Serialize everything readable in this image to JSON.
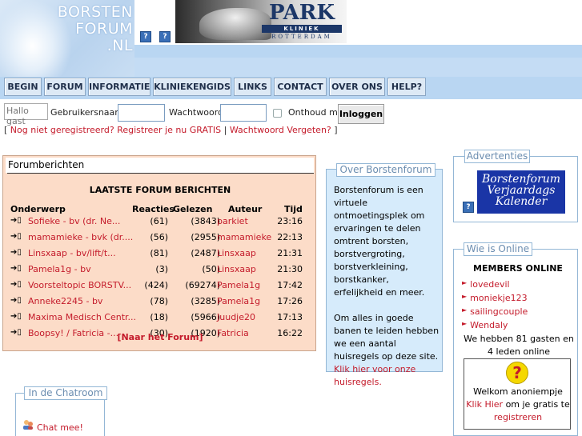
{
  "logo": {
    "line1": "BORSTEN",
    "line2": "FORUM",
    "line3": ".NL"
  },
  "park": {
    "brand": "PARK",
    "sub": "KLINIEK",
    "city": "ROTTERDAM"
  },
  "nav": [
    "BEGIN",
    "FORUM",
    "INFORMATIE",
    "KLINIEKENGIDS",
    "LINKS",
    "CONTACT",
    "OVER ONS",
    "HELP?"
  ],
  "login": {
    "greeting": "Hallo gast",
    "username_label": "Gebruikersnaam",
    "password_label": "Wachtwoord",
    "remember_label": "Onthoud mij",
    "button": "Inloggen",
    "bracket_open": "[",
    "register_link": "Nog niet geregistreerd? Registreer je nu GRATIS",
    "sep": "|",
    "forgot_link": "Wachtwoord Vergeten?",
    "bracket_close": "]"
  },
  "forum": {
    "title": "Forumberichten",
    "subtitle": "LAATSTE FORUM BERICHTEN",
    "headers": {
      "topic": "Onderwerp",
      "replies": "Reacties",
      "reads": "Gelezen",
      "author": "Auteur",
      "time": "Tijd"
    },
    "rows": [
      {
        "topic": "Sofieke - bv (dr. Ne...",
        "replies": "(61)",
        "reads": "(3843)",
        "author": "parkiet",
        "time": "23:16"
      },
      {
        "topic": "mamamieke - bvk (dr....",
        "replies": "(56)",
        "reads": "(2955)",
        "author": "mamamieke",
        "time": "22:13"
      },
      {
        "topic": "Linsxaap - bv/lift/t...",
        "replies": "(81)",
        "reads": "(2487)",
        "author": "Linsxaap",
        "time": "21:31"
      },
      {
        "topic": "Pamela1g - bv",
        "replies": "(3)",
        "reads": "(50)",
        "author": "Linsxaap",
        "time": "21:30"
      },
      {
        "topic": "Voorsteltopic BORSTV...",
        "replies": "(424)",
        "reads": "(69274)",
        "author": "Pamela1g",
        "time": "17:42"
      },
      {
        "topic": "Anneke2245 - bv",
        "replies": "(78)",
        "reads": "(3285)",
        "author": "Pamela1g",
        "time": "17:26"
      },
      {
        "topic": "Maxima Medisch Centr...",
        "replies": "(18)",
        "reads": "(5966)",
        "author": "Juudje20",
        "time": "17:13"
      },
      {
        "topic": "Boopsy! / Fatricia -...",
        "replies": "(30)",
        "reads": "(1920)",
        "author": "Fatricia",
        "time": "16:22"
      }
    ],
    "more_link": "[Naar het Forum]"
  },
  "over": {
    "legend": "Over Borstenforum",
    "text1": "Borstenforum is een virtuele ontmoetingsplek om ervaringen te delen omtrent borsten, borstvergroting, borstverkleining, borstkanker, erfelijkheid en meer.",
    "text2": "Om alles in goede banen te leiden hebben we een aantal huisregels op deze site.",
    "link": "Klik hier voor onze huisregels."
  },
  "ads": {
    "legend": "Advertenties",
    "banner_line1": "Borstenforum",
    "banner_line2": "Verjaardags",
    "banner_line3": "Kalender"
  },
  "online": {
    "legend": "Wie is Online",
    "title": "MEMBERS ONLINE",
    "members": [
      "lovedevil",
      "moniekje123",
      "sailingcouple",
      "Wendaly"
    ],
    "summary": "We hebben 81 gasten en 4 leden online"
  },
  "welkom": {
    "text1": "Welkom anoniempje",
    "link1": "Klik Hier",
    "text2": "om je gratis te",
    "link2": "registreren"
  },
  "chat": {
    "legend": "In de Chatroom",
    "link": "Chat mee!"
  },
  "colors": {
    "accent": "#b9d6f2",
    "link": "#c41b2b",
    "forum_bg": "#fcdcc8",
    "box_bg": "#d6ebfb"
  }
}
